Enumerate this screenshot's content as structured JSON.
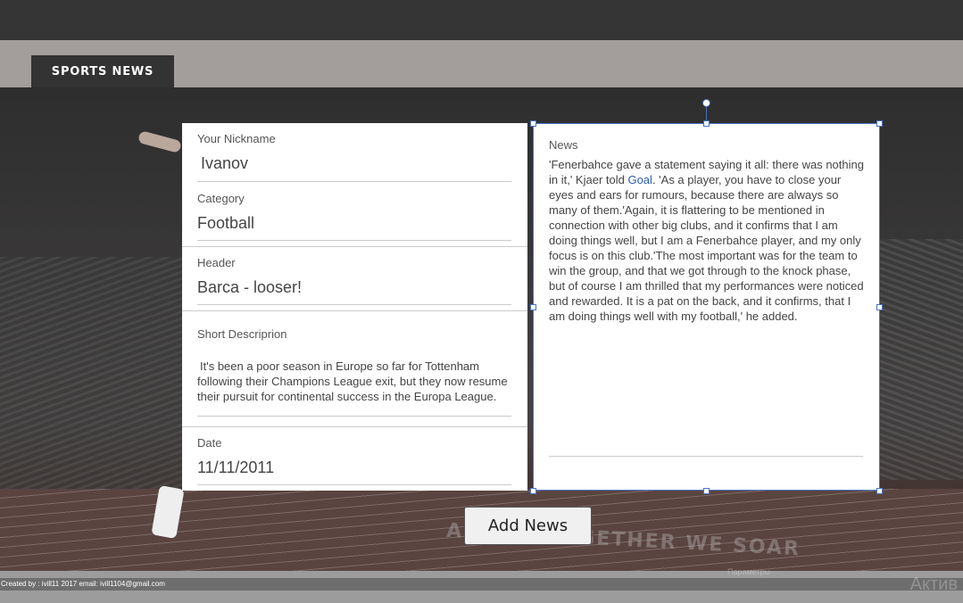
{
  "nav": {
    "tab_label": "SPORTS NEWS"
  },
  "background": {
    "slogan": "A JUMP TOGETHER WE SOAR"
  },
  "form": {
    "nickname": {
      "label": "Your Nickname",
      "value": "Ivanov"
    },
    "category": {
      "label": "Category",
      "value": "Football"
    },
    "header": {
      "label": "Header",
      "value": "Barca - looser!"
    },
    "short_description": {
      "label": "Short Descriprion",
      "value": "It's been a poor season in Europe so far for Tottenham following their Champions League exit, but they now resume their pursuit for continental success in the Europa League."
    },
    "date": {
      "label": "Date",
      "value": "11/11/2011"
    }
  },
  "news": {
    "label": "News",
    "text_part1": "'Fenerbahce gave a statement saying it all: there was nothing in it,' Kjaer told ",
    "link_text": "Goal",
    "text_part2": ". 'As a player, you have to close your eyes and ears for rumours, because there are always so many of them.'Again, it is flattering to be mentioned in connection with other big clubs, and it confirms that I am doing things well, but I am a Fenerbahce player, and my only focus is on this club.'The most important was for the team to win the group, and that we got through to the knock phase, but of course I am thrilled that my performances were noticed and rewarded. It is a pat on the back, and it confirms, that I am doing things well with my football,' he added."
  },
  "actions": {
    "add_news_label": "Add News"
  },
  "footer": {
    "credits": "Created by : ivill11 2017 email: ivill1104@gmail.com",
    "watermark": "Актив",
    "ghost_text": "Параметры"
  }
}
